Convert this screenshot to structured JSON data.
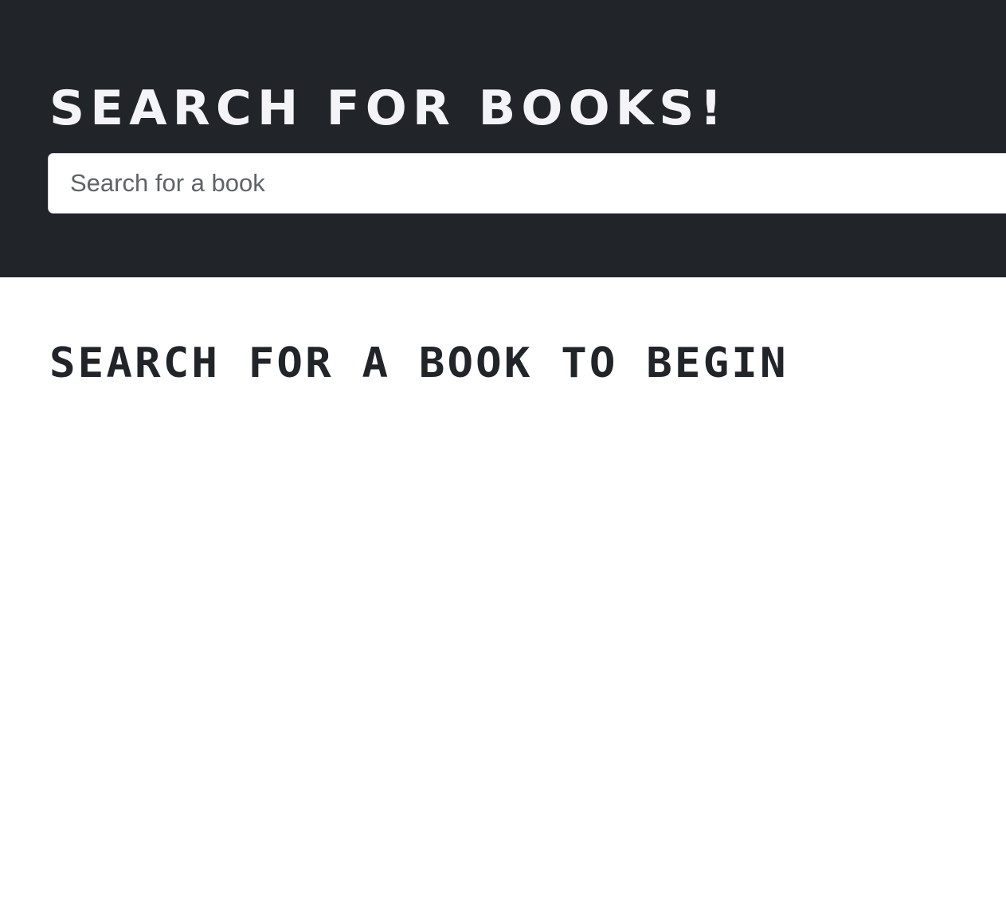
{
  "header": {
    "title": "SEARCH FOR BOOKS!",
    "background_color": "#212429",
    "title_color": "#f4f4f8"
  },
  "search": {
    "value": "",
    "placeholder": "Search for a book"
  },
  "main": {
    "empty_message": "SEARCH FOR A BOOK TO BEGIN"
  }
}
